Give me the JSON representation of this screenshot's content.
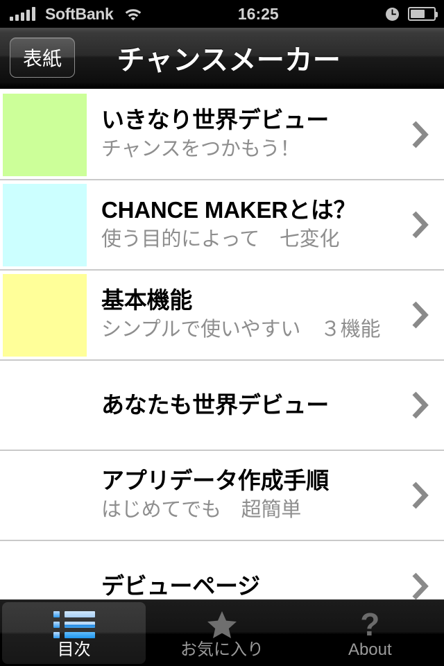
{
  "status_bar": {
    "carrier": "SoftBank",
    "time": "16:25",
    "signal_icon": "signal-bars-icon",
    "wifi_icon": "wifi-icon",
    "alarm_icon": "clock-icon",
    "battery_icon": "battery-icon",
    "battery_level_percent": 62
  },
  "nav_bar": {
    "back_label": "表紙",
    "title": "チャンスメーカー"
  },
  "list": {
    "rows": [
      {
        "title": "いきなり世界デビュー",
        "subtitle": "チャンスをつかもう！",
        "thumb_color": "#ccff99",
        "has_thumb": true,
        "chevron": "chevron-right-icon"
      },
      {
        "title": "CHANCE MAKERとは？",
        "subtitle": "使う目的によって　七変化",
        "thumb_color": "#ccffff",
        "has_thumb": true,
        "chevron": "chevron-right-icon"
      },
      {
        "title": "基本機能",
        "subtitle": "シンプルで使いやすい　３機能",
        "thumb_color": "#ffff99",
        "has_thumb": true,
        "chevron": "chevron-right-icon"
      },
      {
        "title": "あなたも世界デビュー",
        "subtitle": "",
        "thumb_color": "",
        "has_thumb": false,
        "chevron": "chevron-right-icon"
      },
      {
        "title": "アプリデータ作成手順",
        "subtitle": "はじめてでも　超簡単",
        "thumb_color": "",
        "has_thumb": false,
        "chevron": "chevron-right-icon"
      },
      {
        "title": "デビューページ",
        "subtitle": "",
        "thumb_color": "",
        "has_thumb": false,
        "chevron": "chevron-right-icon"
      }
    ]
  },
  "tab_bar": {
    "tabs": [
      {
        "label": "目次",
        "icon": "list-icon",
        "active": true
      },
      {
        "label": "お気に入り",
        "icon": "star-icon",
        "active": false
      },
      {
        "label": "About",
        "icon": "question-mark-icon",
        "active": false
      }
    ]
  },
  "colors": {
    "separator": "#c9c9c9",
    "title_text": "#000000",
    "subtitle_text": "#8e8e8e",
    "chevron": "#8a8a8a",
    "accent_blue": "#2f9bf0",
    "nav_background": "#1a1a1a",
    "tab_active_label": "#ffffff",
    "tab_inactive_label": "#9a9a9a"
  }
}
